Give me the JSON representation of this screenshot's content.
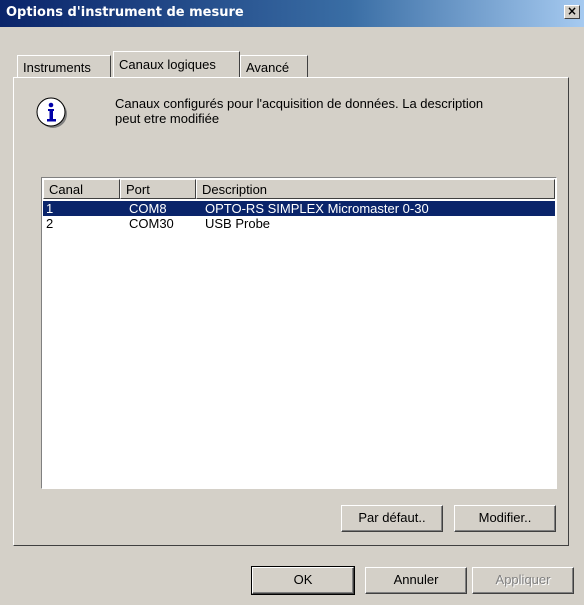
{
  "window": {
    "title": "Options d'instrument de mesure",
    "close_glyph": "×"
  },
  "tabs": [
    {
      "label": "Instruments",
      "active": false
    },
    {
      "label": "Canaux logiques",
      "active": true
    },
    {
      "label": "Avancé",
      "active": false
    }
  ],
  "info": {
    "icon": "info-icon",
    "line1": "Canaux configurés pour l'acquisition de données. La description",
    "line2": "peut etre modifiée"
  },
  "list": {
    "columns": [
      "Canal",
      "Port",
      "Description"
    ],
    "rows": [
      {
        "canal": "1",
        "port": "COM8",
        "description": "OPTO-RS SIMPLEX Micromaster 0-30",
        "selected": true
      },
      {
        "canal": "2",
        "port": "COM30",
        "description": "USB Probe",
        "selected": false
      }
    ],
    "selection_color": "#0a246a"
  },
  "panel_buttons": {
    "default_label": "Par défaut..",
    "modify_label": "Modifier.."
  },
  "dialog_buttons": {
    "ok_label": "OK",
    "cancel_label": "Annuler",
    "apply_label": "Appliquer"
  },
  "colors": {
    "face": "#d4d0c8",
    "title_start": "#0a246a",
    "title_end": "#a6caf0"
  }
}
